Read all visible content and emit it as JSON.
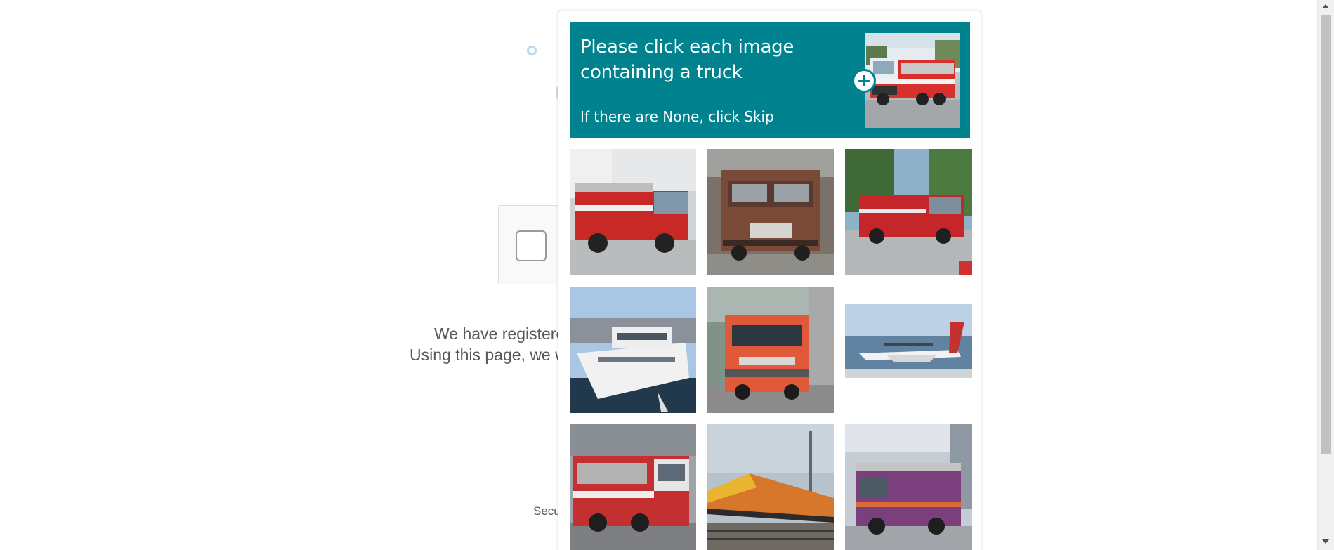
{
  "background": {
    "text_line_1": "We have registere",
    "text_line_2": "Using this page, we w",
    "footer_text": "Secu"
  },
  "challenge": {
    "prompt_title": "Please click each image containing a truck",
    "prompt_subtitle": "If there are None, click Skip",
    "example_icon": "plus-icon",
    "accent_color": "#00838f",
    "tiles": [
      {
        "subject": "red fire truck"
      },
      {
        "subject": "brown truck"
      },
      {
        "subject": "red fire truck"
      },
      {
        "subject": "white yacht"
      },
      {
        "subject": "orange fire truck"
      },
      {
        "subject": "seaplane"
      },
      {
        "subject": "red fire truck"
      },
      {
        "subject": "orange locomotive"
      },
      {
        "subject": "purple fire truck"
      }
    ]
  }
}
